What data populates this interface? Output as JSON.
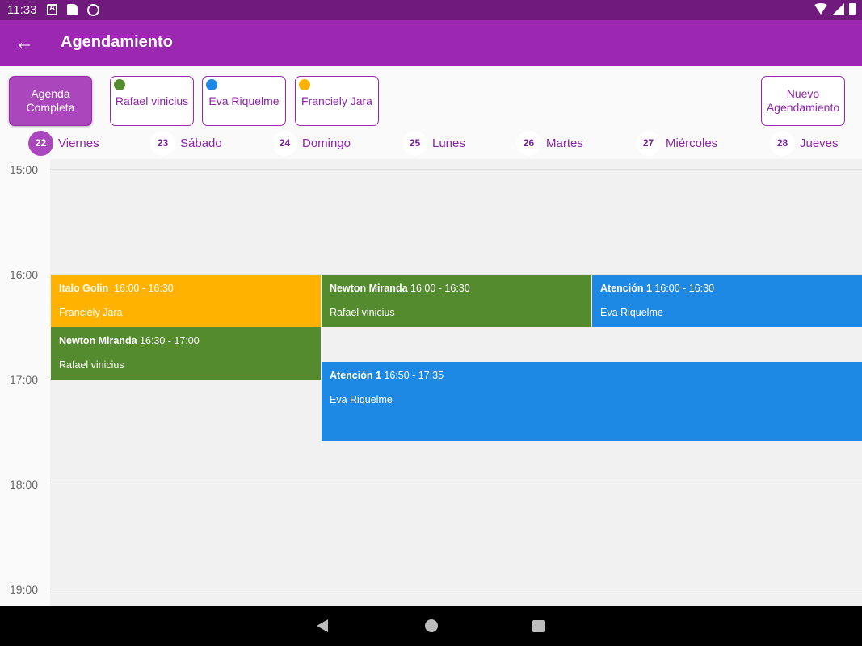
{
  "status_bar": {
    "time": "11:33",
    "icons": [
      "a-icon",
      "sd-card-icon",
      "sync-icon",
      "wifi-icon",
      "signal-icon",
      "battery-icon"
    ]
  },
  "app_bar": {
    "title": "Agendamiento",
    "back_icon": "←"
  },
  "filters": {
    "all_label_line1": "Agenda",
    "all_label_line2": "Completa",
    "professionals": [
      {
        "name": "Rafael vinicius",
        "color": "#558b2f"
      },
      {
        "name": "Eva Riquelme",
        "color": "#1e88e5"
      },
      {
        "name": "Franciely Jara",
        "color": "#ffb300"
      }
    ],
    "new_label_line1": "Nuevo",
    "new_label_line2": "Agendamiento"
  },
  "days": [
    {
      "num": "22",
      "name": "Viernes",
      "selected": true
    },
    {
      "num": "23",
      "name": "Sábado"
    },
    {
      "num": "24",
      "name": "Domingo"
    },
    {
      "num": "25",
      "name": "Lunes"
    },
    {
      "num": "26",
      "name": "Martes"
    },
    {
      "num": "27",
      "name": "Miércoles"
    },
    {
      "num": "28",
      "name": "Jueves"
    }
  ],
  "hours": [
    "15:00",
    "16:00",
    "17:00",
    "18:00",
    "19:00"
  ],
  "events": [
    {
      "title": "Italo Golin",
      "time": "16:00 - 16:30",
      "professional": "Franciely Jara",
      "color": "#ffb300"
    },
    {
      "title": "Newton Miranda",
      "time": "16:00 - 16:30",
      "professional": "Rafael vinicius",
      "color": "#558b2f"
    },
    {
      "title": "Atención 1",
      "time": "16:00 - 16:30",
      "professional": "Eva Riquelme",
      "color": "#1e88e5"
    },
    {
      "title": "Newton Miranda",
      "time": "16:30 - 17:00",
      "professional": "Rafael vinicius",
      "color": "#558b2f"
    },
    {
      "title": "Atención 1",
      "time": "16:50 - 17:35",
      "professional": "Eva Riquelme",
      "color": "#1e88e5"
    }
  ]
}
